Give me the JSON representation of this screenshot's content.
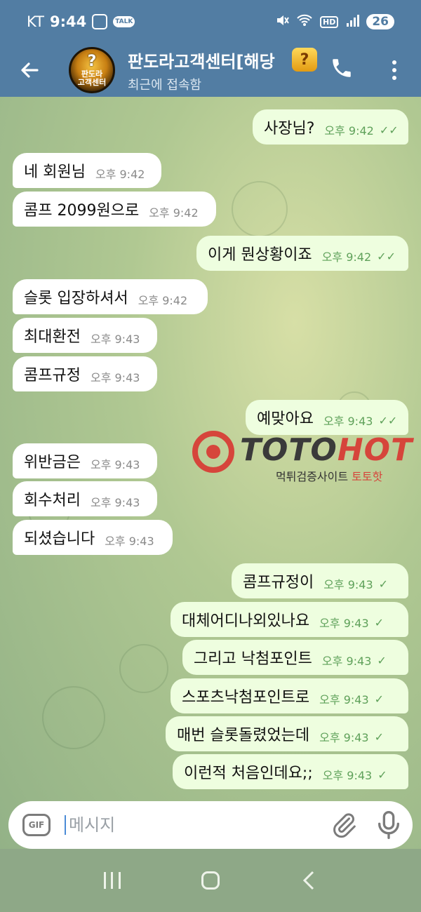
{
  "status_bar": {
    "carrier": "KT",
    "time": "9:44",
    "talk_badge": "TALK",
    "hd_badge": "HD",
    "battery": "26"
  },
  "header": {
    "title": "판도라고객센터[해당",
    "title_icon": "?",
    "subtitle": "최근에 접속함",
    "avatar_lines": [
      "판도라",
      "고객센터"
    ]
  },
  "messages": [
    {
      "dir": "out",
      "text": "사장님?",
      "time": "오후 9:42",
      "status": "read"
    },
    {
      "dir": "in",
      "text": "네 회원님",
      "time": "오후 9:42"
    },
    {
      "dir": "in",
      "text": "콤프 2099원으로",
      "time": "오후 9:42"
    },
    {
      "dir": "out",
      "text": "이게 뭔상황이죠",
      "time": "오후 9:42",
      "status": "read"
    },
    {
      "dir": "in",
      "text": "슬롯 입장하셔서",
      "time": "오후 9:42"
    },
    {
      "dir": "in",
      "text": "최대환전",
      "time": "오후 9:43"
    },
    {
      "dir": "in",
      "text": "콤프규정",
      "time": "오후 9:43"
    },
    {
      "dir": "out",
      "text": "예맞아요",
      "time": "오후 9:43",
      "status": "read"
    },
    {
      "dir": "in",
      "text": "위반금은",
      "time": "오후 9:43"
    },
    {
      "dir": "in",
      "text": "회수처리",
      "time": "오후 9:43"
    },
    {
      "dir": "in",
      "text": "되셨습니다",
      "time": "오후 9:43"
    },
    {
      "dir": "out",
      "text": "콤프규정이",
      "time": "오후 9:43",
      "status": "sent"
    },
    {
      "dir": "out",
      "text": "대체어디나외있나요",
      "time": "오후 9:43",
      "status": "sent"
    },
    {
      "dir": "out",
      "text": "그리고 낙첨포인트",
      "time": "오후 9:43",
      "status": "sent"
    },
    {
      "dir": "out",
      "text": "스포츠낙첨포인트로",
      "time": "오후 9:43",
      "status": "sent"
    },
    {
      "dir": "out",
      "text": "매번 슬롯돌렸었는데",
      "time": "오후 9:43",
      "status": "sent"
    },
    {
      "dir": "out",
      "text": "이런적 처음인데요;;",
      "time": "오후 9:43",
      "status": "sent"
    }
  ],
  "watermark": {
    "brand_a": "TOTO",
    "brand_b": "HOT",
    "sub_a": "먹튀검증사이트 ",
    "sub_b": "토토핫"
  },
  "input": {
    "gif_label": "GIF",
    "placeholder": "메시지"
  },
  "icons": {
    "back": "arrow-left-icon",
    "call": "phone-icon",
    "menu": "more-vert-icon",
    "attach": "paperclip-icon",
    "mic": "microphone-icon"
  },
  "colors": {
    "header": "#527da3",
    "outgoing_bubble": "#eefedf",
    "incoming_bubble": "#ffffff",
    "check": "#5fa15a",
    "watermark_red": "#d6453b"
  }
}
